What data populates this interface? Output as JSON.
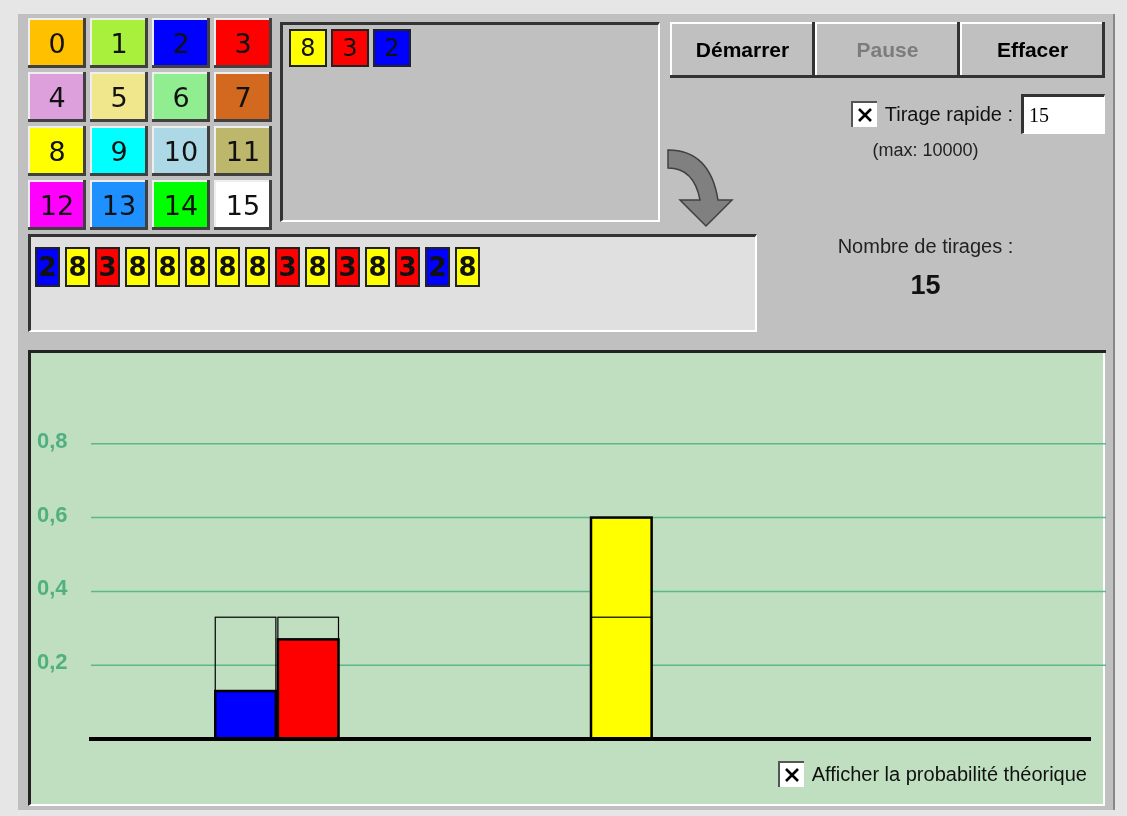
{
  "palette": [
    {
      "number": "0",
      "color": "#ffc000"
    },
    {
      "number": "1",
      "color": "#a8f03c"
    },
    {
      "number": "2",
      "color": "#0000ff"
    },
    {
      "number": "3",
      "color": "#ff0000"
    },
    {
      "number": "4",
      "color": "#dda0dd"
    },
    {
      "number": "5",
      "color": "#f0e68c"
    },
    {
      "number": "6",
      "color": "#90ee90"
    },
    {
      "number": "7",
      "color": "#d2691e"
    },
    {
      "number": "8",
      "color": "#ffff00"
    },
    {
      "number": "9",
      "color": "#00ffff"
    },
    {
      "number": "10",
      "color": "#add8e6"
    },
    {
      "number": "11",
      "color": "#bdb76b"
    },
    {
      "number": "12",
      "color": "#ff00ff"
    },
    {
      "number": "13",
      "color": "#1e90ff"
    },
    {
      "number": "14",
      "color": "#00ff00"
    },
    {
      "number": "15",
      "color": "#ffffff"
    }
  ],
  "urn": [
    {
      "number": "8",
      "color": "#ffff00"
    },
    {
      "number": "3",
      "color": "#ff0000"
    },
    {
      "number": "2",
      "color": "#0000ff"
    }
  ],
  "history": [
    {
      "number": "2",
      "color": "#0000ff"
    },
    {
      "number": "8",
      "color": "#ffff00"
    },
    {
      "number": "3",
      "color": "#ff0000"
    },
    {
      "number": "8",
      "color": "#ffff00"
    },
    {
      "number": "8",
      "color": "#ffff00"
    },
    {
      "number": "8",
      "color": "#ffff00"
    },
    {
      "number": "8",
      "color": "#ffff00"
    },
    {
      "number": "8",
      "color": "#ffff00"
    },
    {
      "number": "3",
      "color": "#ff0000"
    },
    {
      "number": "8",
      "color": "#ffff00"
    },
    {
      "number": "3",
      "color": "#ff0000"
    },
    {
      "number": "8",
      "color": "#ffff00"
    },
    {
      "number": "3",
      "color": "#ff0000"
    },
    {
      "number": "2",
      "color": "#0000ff"
    },
    {
      "number": "8",
      "color": "#ffff00"
    }
  ],
  "buttons": [
    {
      "label": "Démarrer",
      "disabled": false
    },
    {
      "label": "Pause",
      "disabled": true
    },
    {
      "label": "Effacer",
      "disabled": false
    }
  ],
  "fast_draw": {
    "label": "Tirage rapide :",
    "checked": true,
    "value": "15",
    "hint": "(max: 10000)"
  },
  "draw_count": {
    "label": "Nombre de tirages :",
    "value": "15"
  },
  "chart": {
    "chart_data": {
      "type": "bar",
      "grid": true,
      "ylim": [
        0,
        1.05
      ],
      "yticks": [
        {
          "value": 0.2,
          "label": "0,2"
        },
        {
          "value": 0.4,
          "label": "0,4"
        },
        {
          "value": 0.6,
          "label": "0,6"
        },
        {
          "value": 0.8,
          "label": "0,8"
        }
      ],
      "series": [
        {
          "values": [
            null,
            null,
            0.13,
            0.27,
            null,
            null,
            null,
            null,
            0.6,
            null,
            null,
            null,
            null,
            null,
            null,
            null
          ],
          "colors": [
            null,
            null,
            "#0000ff",
            "#ff0000",
            null,
            null,
            null,
            null,
            "#ffff00",
            null,
            null,
            null,
            null,
            null,
            null,
            null
          ]
        },
        {
          "values": [
            null,
            null,
            0.33,
            0.33,
            null,
            null,
            null,
            null,
            0.33,
            null,
            null,
            null,
            null,
            null,
            null,
            null
          ]
        }
      ]
    },
    "show_theoretical": {
      "label": "Afficher la probabilité théorique",
      "checked": true
    }
  }
}
